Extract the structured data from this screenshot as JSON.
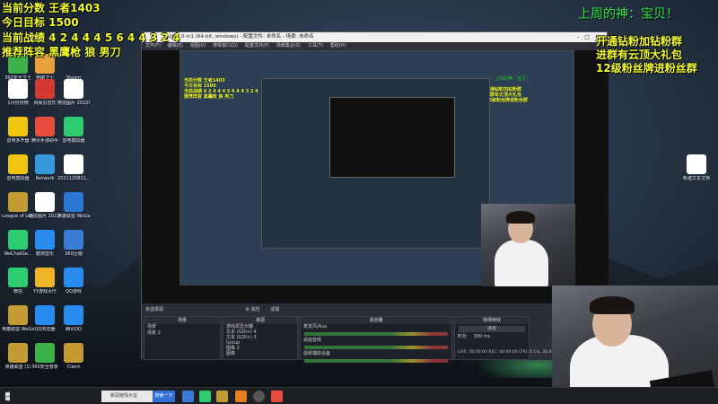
{
  "overlay": {
    "line1": "当前分数 王者1403",
    "line2": "今日目标 1500",
    "line3": "当前战绩 4 2 4 4 4 5 6 4 4 3 2 4",
    "line4": "推荐阵容 黑鹰枪 狼 男刀",
    "god": "上周的神：宝贝！",
    "promo1": "开通钻粉加钻粉群",
    "promo2": "进群有云顶大礼包",
    "promo3": "12级粉丝牌进粉丝群"
  },
  "desktop_icons": [
    {
      "label": "360安全卫士",
      "color": "#3db24b"
    },
    {
      "label": "电脑卫士",
      "color": "#e9a13b"
    },
    {
      "label": "Steam",
      "color": "#1b2838"
    },
    {
      "label": "1月份份物",
      "color": "#ffffff"
    },
    {
      "label": "网易云音乐",
      "color": "#d33a31"
    },
    {
      "label": "微信图片 2022021...",
      "color": "#ffffff"
    },
    {
      "label": "雷电多开器",
      "color": "#f1c40f"
    },
    {
      "label": "腾讯手游助手",
      "color": "#e74c3c"
    },
    {
      "label": "雷电模拟器",
      "color": "#2ecc71"
    },
    {
      "label": "雷电模拟器",
      "color": "#f1c40f"
    },
    {
      "label": "Network",
      "color": "#3498db"
    },
    {
      "label": "2021120811...",
      "color": "#ffffff"
    },
    {
      "label": "League of Legends",
      "color": "#c49a32"
    },
    {
      "label": "微信图片 2022021...",
      "color": "#ffffff"
    },
    {
      "label": "英雄联盟 WeGame版",
      "color": "#2c77d6"
    },
    {
      "label": "WeChatGe...",
      "color": "#2ecc71"
    },
    {
      "label": "酷狗音乐",
      "color": "#2a8cf0"
    },
    {
      "label": "360压缩",
      "color": "#3a7bd5"
    },
    {
      "label": "微信",
      "color": "#2ecc71"
    },
    {
      "label": "YY游戏大厅",
      "color": "#f0b429"
    },
    {
      "label": "QQ游戏",
      "color": "#2a8cf0"
    },
    {
      "label": "英雄联盟 WeGame版",
      "color": "#c49a32"
    },
    {
      "label": "QQ浏览器",
      "color": "#2a8cf0"
    },
    {
      "label": "腾讯QQ",
      "color": "#2a8cf0"
    },
    {
      "label": "Client",
      "color": "#c49a32"
    },
    {
      "label": "英雄联盟 (1)",
      "color": "#c49a32"
    },
    {
      "label": "360安全管家",
      "color": "#3db24b"
    },
    {
      "label": "新建文本文档",
      "color": "#ffffff"
    }
  ],
  "obs": {
    "title": "26.1.0-rc1 (64-bit, windows) - 配置文件: 未命名 - 场景: 未命名",
    "menu": [
      "文件(F)",
      "编辑(E)",
      "视图(V)",
      "停靠窗口(D)",
      "配置文件(P)",
      "场景集合(S)",
      "工具(T)",
      "帮助(H)"
    ],
    "scene_bar": "未选择源",
    "toolbar_props": "属性",
    "toolbar_filters": "滤镜",
    "scenes_header": "场景",
    "scenes": [
      "场景",
      "场景 2"
    ],
    "sources_header": "来源",
    "sources": [
      "游戏源显示器",
      "文本 (GDI+) 4",
      "文本 (GDI+) 3",
      "Group",
      "图像 2",
      "图像"
    ],
    "mixer_header": "混音器",
    "mixer": [
      "麦克风/Aux",
      "桌面音频",
      "视频捕获设备"
    ],
    "transitions_header": "转场特效",
    "transition": "淡出",
    "duration_label": "时长",
    "duration": "300 ms",
    "status": "LIVE: 00:00:00  REC: 00:00:00  CPU: 8.1%, 30.00 fps"
  },
  "taskbar": {
    "search_text": "新冠疫情大征",
    "search_button": "搜索一下"
  }
}
